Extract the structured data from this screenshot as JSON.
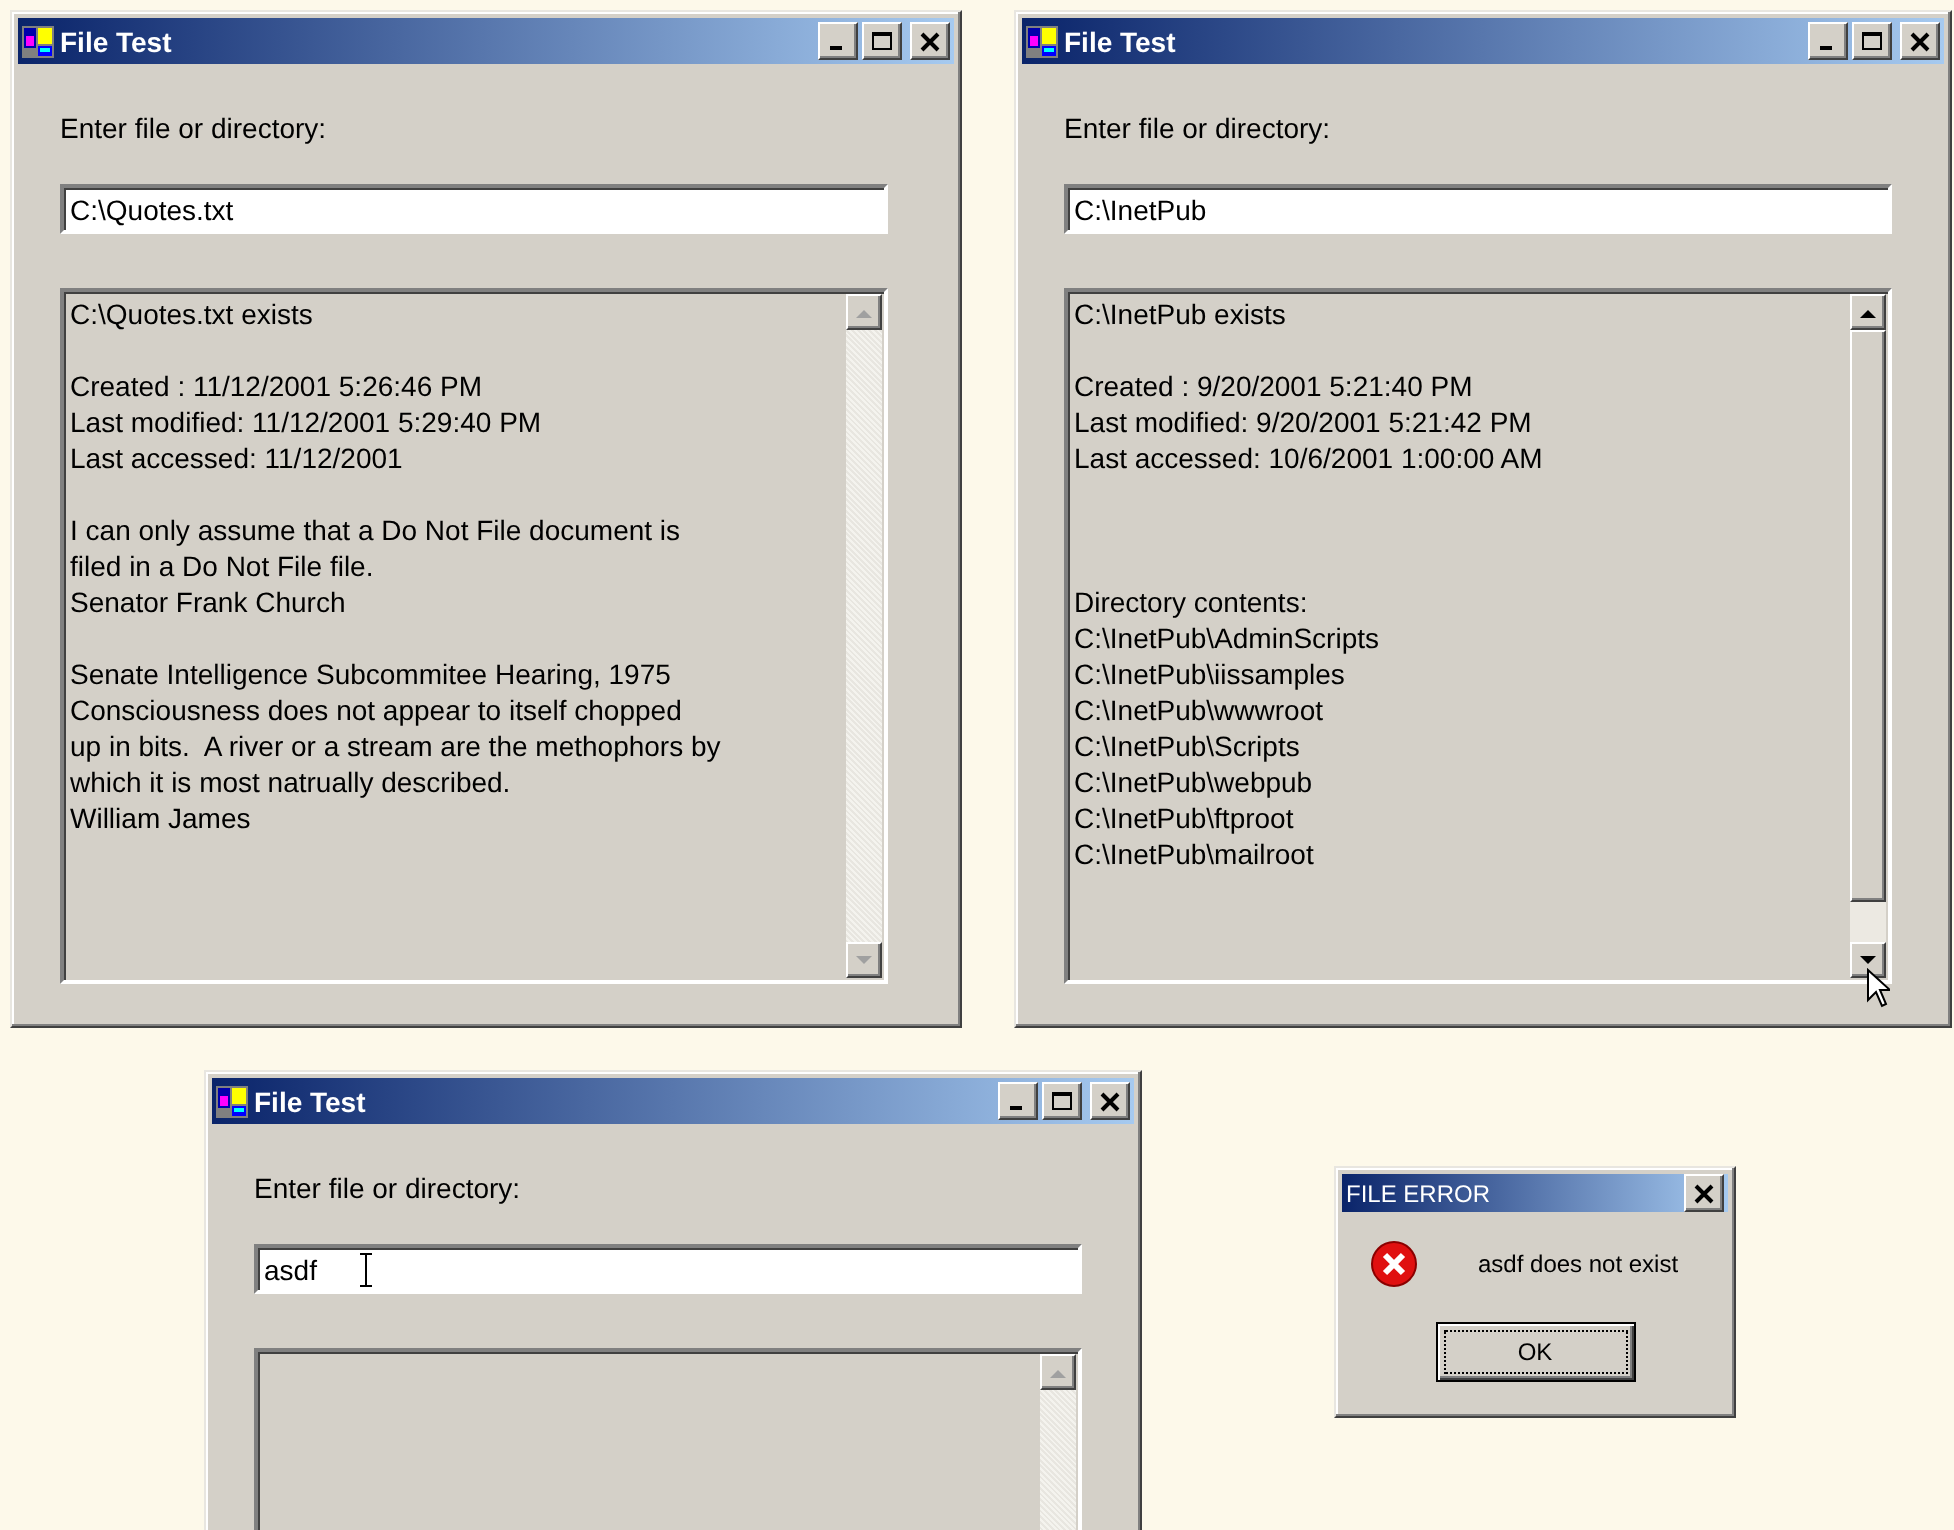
{
  "windows": [
    {
      "title": "File Test",
      "prompt": "Enter file or directory:",
      "input": {
        "value": "C:\\Quotes.txt"
      },
      "output": {
        "blocks": [
          {
            "kind": "text",
            "lines": [
              "C:\\Quotes.txt exists"
            ]
          },
          {
            "kind": "text",
            "lines": [
              "Created : 11/12/2001 5:26:46 PM",
              "Last modified: 11/12/2001 5:29:40 PM",
              "Last accessed: 11/12/2001"
            ]
          },
          {
            "kind": "text",
            "lines": [
              "I can only assume that a Do Not File document is",
              "filed in a Do Not File file.",
              "Senator Frank Church"
            ]
          },
          {
            "kind": "text",
            "lines": [
              "Senate Intelligence Subcommitee Hearing, 1975",
              "Consciousness does not appear to itself chopped",
              "up in bits.  A river or a stream are the methophors by",
              "which it is most natrually described.",
              "William James"
            ]
          }
        ]
      },
      "scrollbar": {
        "disabled": true
      }
    },
    {
      "title": "File Test",
      "prompt": "Enter file or directory:",
      "input": {
        "value": "C:\\InetPub"
      },
      "output": {
        "blocks": [
          {
            "kind": "text",
            "lines": [
              "C:\\InetPub exists"
            ]
          },
          {
            "kind": "text",
            "lines": [
              "Created : 9/20/2001 5:21:40 PM",
              "Last modified: 9/20/2001 5:21:42 PM",
              "Last accessed: 10/6/2001 1:00:00 AM"
            ]
          },
          {
            "kind": "listing",
            "lines": [
              "Directory contents:",
              "C:\\InetPub\\AdminScripts",
              "C:\\InetPub\\iissamples",
              "C:\\InetPub\\wwwroot",
              "C:\\InetPub\\Scripts",
              "C:\\InetPub\\webpub",
              "C:\\InetPub\\ftproot",
              "C:\\InetPub\\mailroot"
            ]
          }
        ]
      },
      "scrollbar": {
        "disabled": false,
        "mouse_pointer": true
      }
    },
    {
      "title": "File Test",
      "prompt": "Enter file or directory:",
      "input": {
        "value": "asdf",
        "mouse_pointer": true
      },
      "scrollbar": {
        "disabled": true
      }
    }
  ],
  "dialog": {
    "title": "FILE ERROR",
    "message": "asdf does not exist",
    "button": "OK"
  }
}
